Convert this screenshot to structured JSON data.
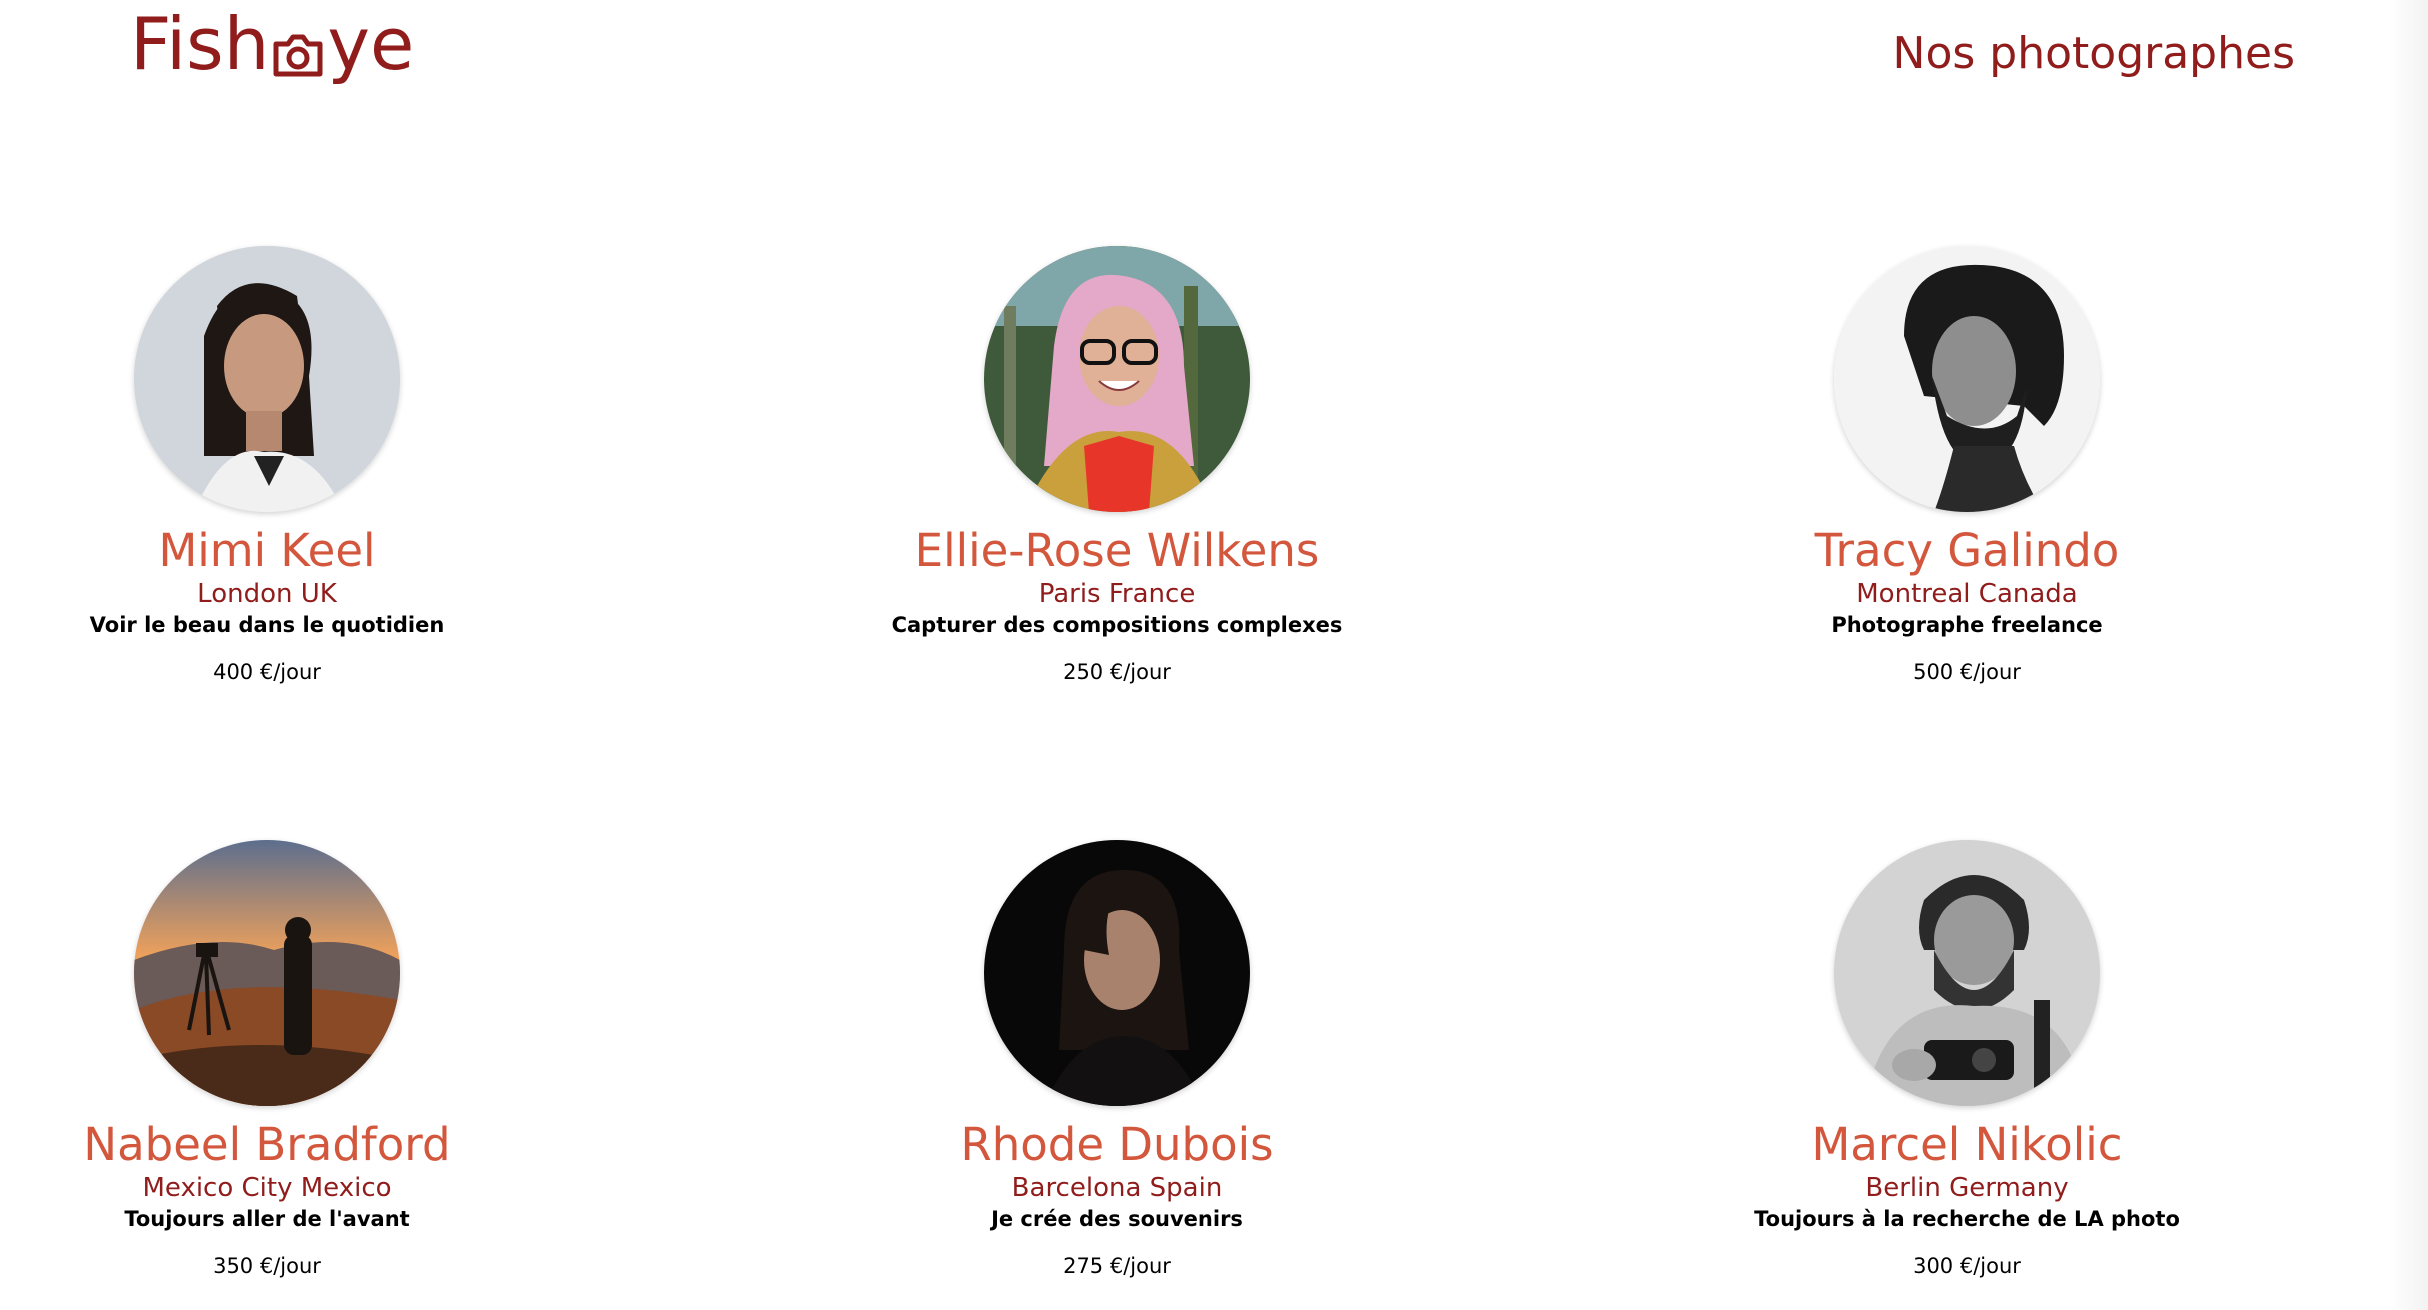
{
  "header": {
    "logo_left": "Fish",
    "logo_right": "ye",
    "logo_icon": "camera-icon",
    "title": "Nos photographes"
  },
  "colors": {
    "brand": "#901C1C",
    "name": "#D3573C",
    "text": "#000000"
  },
  "photographers": [
    {
      "name": "Mimi Keel",
      "location": "London UK",
      "tagline": "Voir le beau dans le quotidien",
      "price": "400 €/jour"
    },
    {
      "name": "Ellie-Rose Wilkens",
      "location": "Paris France",
      "tagline": "Capturer des compositions complexes",
      "price": "250 €/jour"
    },
    {
      "name": "Tracy Galindo",
      "location": "Montreal Canada",
      "tagline": "Photographe freelance",
      "price": "500 €/jour"
    },
    {
      "name": "Nabeel Bradford",
      "location": "Mexico City Mexico",
      "tagline": "Toujours aller de l'avant",
      "price": "350 €/jour"
    },
    {
      "name": "Rhode Dubois",
      "location": "Barcelona Spain",
      "tagline": "Je crée des souvenirs",
      "price": "275 €/jour"
    },
    {
      "name": "Marcel Nikolic",
      "location": "Berlin Germany",
      "tagline": "Toujours à la recherche de LA photo",
      "price": "300 €/jour"
    }
  ]
}
